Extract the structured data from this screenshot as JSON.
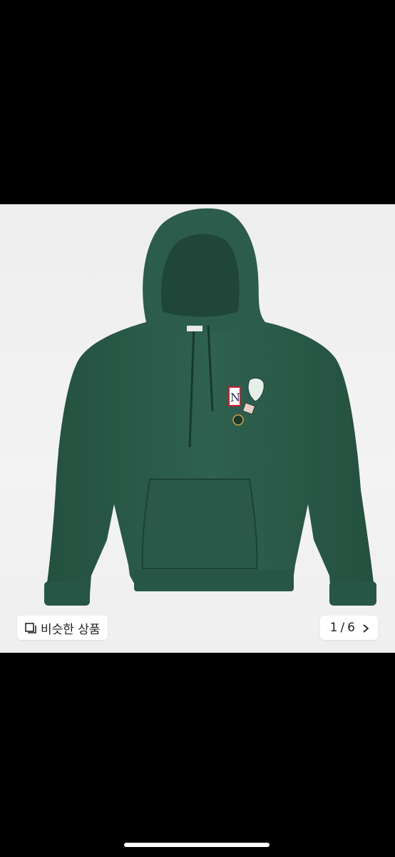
{
  "gallery": {
    "similar_label": "비슷한 상품",
    "current_index": "1",
    "separator": "/",
    "total": "6"
  },
  "colors": {
    "hoodie": "#2e5e4e",
    "background": "#f1f1f1"
  },
  "icons": {
    "similar": "square-stack-icon",
    "next": "chevron-right-icon"
  }
}
